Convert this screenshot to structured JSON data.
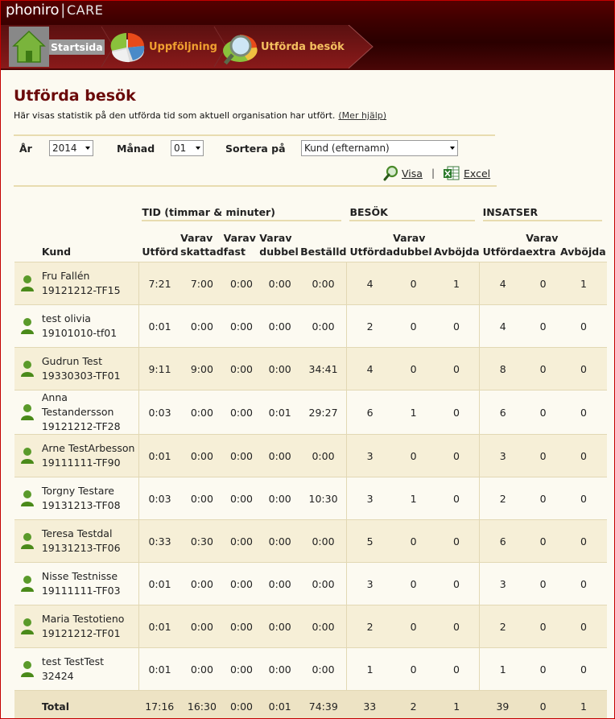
{
  "header": {
    "logo_name": "phoniro",
    "logo_sep": "|",
    "logo_product": "CARE",
    "nav": [
      {
        "label": "Startsida",
        "icon": "house-icon"
      },
      {
        "label": "Uppföljning",
        "icon": "pie-chart-icon"
      },
      {
        "label": "Utförda besök",
        "icon": "magnifier-chart-icon"
      }
    ]
  },
  "page": {
    "title": "Utförda besök",
    "subtitle": "Här visas statistik på den utförda tid som aktuell organisation har utfört.",
    "help_link": "(Mer hjälp)"
  },
  "filters": {
    "year_label": "År",
    "year_value": "2014",
    "month_label": "Månad",
    "month_value": "01",
    "sort_label": "Sortera på",
    "sort_value": "Kund (efternamn)"
  },
  "actions": {
    "show": "Visa",
    "sep": "|",
    "excel": "Excel"
  },
  "table": {
    "groups": {
      "tid": "TID (timmar & minuter)",
      "besok": "BESÖK",
      "insatser": "INSATSER"
    },
    "columns": {
      "kund": "Kund",
      "tid_utford": "Utförd",
      "tid_skattad": [
        "Varav",
        "skattad"
      ],
      "tid_fast": [
        "Varav",
        "fast"
      ],
      "tid_dubbel": [
        "Varav",
        "dubbel"
      ],
      "tid_bestalld": "Beställd",
      "besok_utforda": "Utförda",
      "besok_dubbel": [
        "Varav",
        "dubbel"
      ],
      "besok_avbojda": "Avböjda",
      "ins_utforda": "Utförda",
      "ins_extra": [
        "Varav",
        "extra"
      ],
      "ins_avbojda": "Avböjda"
    },
    "rows": [
      {
        "name": "Fru Fallén",
        "id": "19121212-TF15",
        "values": [
          "7:21",
          "7:00",
          "0:00",
          "0:00",
          "0:00",
          "4",
          "0",
          "1",
          "4",
          "0",
          "1"
        ]
      },
      {
        "name": "test olivia",
        "id": "19101010-tf01",
        "values": [
          "0:01",
          "0:00",
          "0:00",
          "0:00",
          "0:00",
          "2",
          "0",
          "0",
          "4",
          "0",
          "0"
        ]
      },
      {
        "name": "Gudrun Test",
        "id": "19330303-TF01",
        "values": [
          "9:11",
          "9:00",
          "0:00",
          "0:00",
          "34:41",
          "4",
          "0",
          "0",
          "8",
          "0",
          "0"
        ]
      },
      {
        "name": "Anna Testandersson",
        "id": "19121212-TF28",
        "values": [
          "0:03",
          "0:00",
          "0:00",
          "0:01",
          "29:27",
          "6",
          "1",
          "0",
          "6",
          "0",
          "0"
        ]
      },
      {
        "name": "Arne TestArbesson",
        "id": "19111111-TF90",
        "values": [
          "0:01",
          "0:00",
          "0:00",
          "0:00",
          "0:00",
          "3",
          "0",
          "0",
          "3",
          "0",
          "0"
        ]
      },
      {
        "name": "Torgny Testare",
        "id": "19131213-TF08",
        "values": [
          "0:03",
          "0:00",
          "0:00",
          "0:00",
          "10:30",
          "3",
          "1",
          "0",
          "2",
          "0",
          "0"
        ]
      },
      {
        "name": "Teresa Testdal",
        "id": "19131213-TF06",
        "values": [
          "0:33",
          "0:30",
          "0:00",
          "0:00",
          "0:00",
          "5",
          "0",
          "0",
          "6",
          "0",
          "0"
        ]
      },
      {
        "name": "Nisse Testnisse",
        "id": "19111111-TF03",
        "values": [
          "0:01",
          "0:00",
          "0:00",
          "0:00",
          "0:00",
          "3",
          "0",
          "0",
          "3",
          "0",
          "0"
        ]
      },
      {
        "name": "Maria Testotieno",
        "id": "19121212-TF01",
        "values": [
          "0:01",
          "0:00",
          "0:00",
          "0:00",
          "0:00",
          "2",
          "0",
          "0",
          "2",
          "0",
          "0"
        ]
      },
      {
        "name": "test TestTest",
        "id": "32424",
        "values": [
          "0:01",
          "0:00",
          "0:00",
          "0:00",
          "0:00",
          "1",
          "0",
          "0",
          "1",
          "0",
          "0"
        ]
      }
    ],
    "total": {
      "label": "Total",
      "values": [
        "17:16",
        "16:30",
        "0:00",
        "0:01",
        "74:39",
        "33",
        "2",
        "1",
        "39",
        "0",
        "1"
      ]
    }
  }
}
